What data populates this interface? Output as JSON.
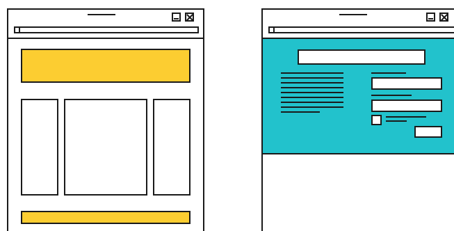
{
  "diagram": {
    "panels": [
      {
        "name": "layout-wireframe",
        "header_color": "#fccd31",
        "footer_color": "#fccd31",
        "columns": [
          "left-sidebar",
          "main-content",
          "right-sidebar"
        ]
      },
      {
        "name": "form-wireframe",
        "hero_color": "#22c2cc",
        "form_fields": [
          "field-1",
          "field-2"
        ],
        "has_checkbox": true,
        "has_submit_button": true
      }
    ],
    "window_controls": [
      "minimize-icon",
      "close-icon"
    ],
    "colors": {
      "stroke": "#1a1a1a",
      "background": "#ffffff",
      "yellow": "#fccd31",
      "teal": "#22c2cc"
    }
  }
}
